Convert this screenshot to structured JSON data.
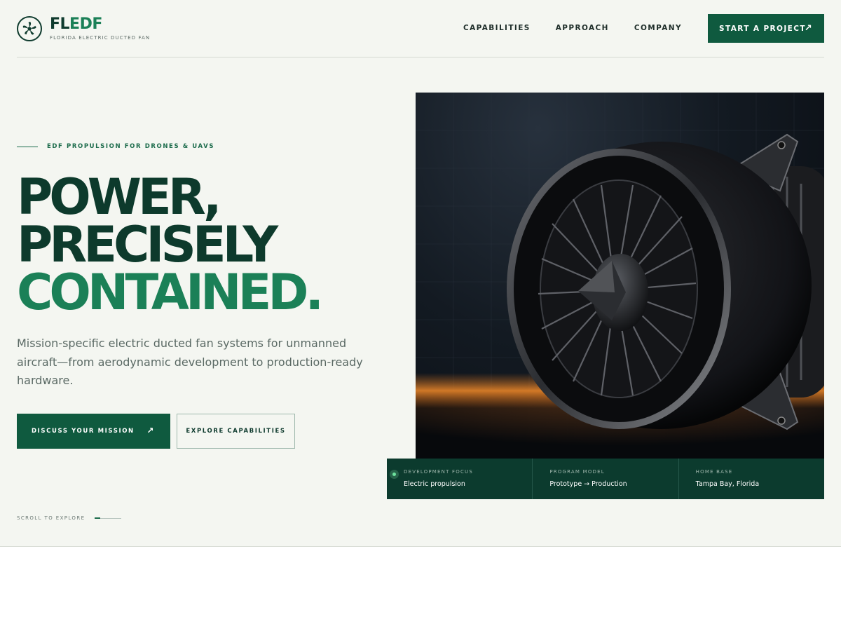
{
  "brand": {
    "name_part1": "FL",
    "name_part2": "EDF",
    "tagline": "FLORIDA ELECTRIC DUCTED FAN"
  },
  "nav": {
    "items": [
      {
        "label": "CAPABILITIES"
      },
      {
        "label": "APPROACH"
      },
      {
        "label": "COMPANY"
      }
    ],
    "cta_label": "START A PROJECT",
    "cta_icon": "arrow-up-right-icon"
  },
  "hero": {
    "eyebrow": "EDF PROPULSION FOR DRONES & UAVS",
    "headline_line1": "POWER,",
    "headline_line2": "PRECISELY",
    "headline_line3": "CONTAINED.",
    "subcopy": "Mission-specific electric ducted fan systems for unmanned aircraft—from aerodynamic development to production-ready hardware.",
    "primary_button": "DISCUSS YOUR MISSION",
    "secondary_button": "EXPLORE CAPABILITIES",
    "scroll_label": "SCROLL TO EXPLORE"
  },
  "stats": [
    {
      "label": "DEVELOPMENT FOCUS",
      "value": "Electric propulsion"
    },
    {
      "label": "PROGRAM MODEL",
      "value": "Prototype → Production"
    },
    {
      "label": "HOME BASE",
      "value": "Tampa Bay, Florida"
    }
  ],
  "colors": {
    "brand_dark": "#0f3b2e",
    "brand_green": "#1b8057",
    "button_green": "#0f5a3f",
    "background": "#f4f6f1"
  }
}
